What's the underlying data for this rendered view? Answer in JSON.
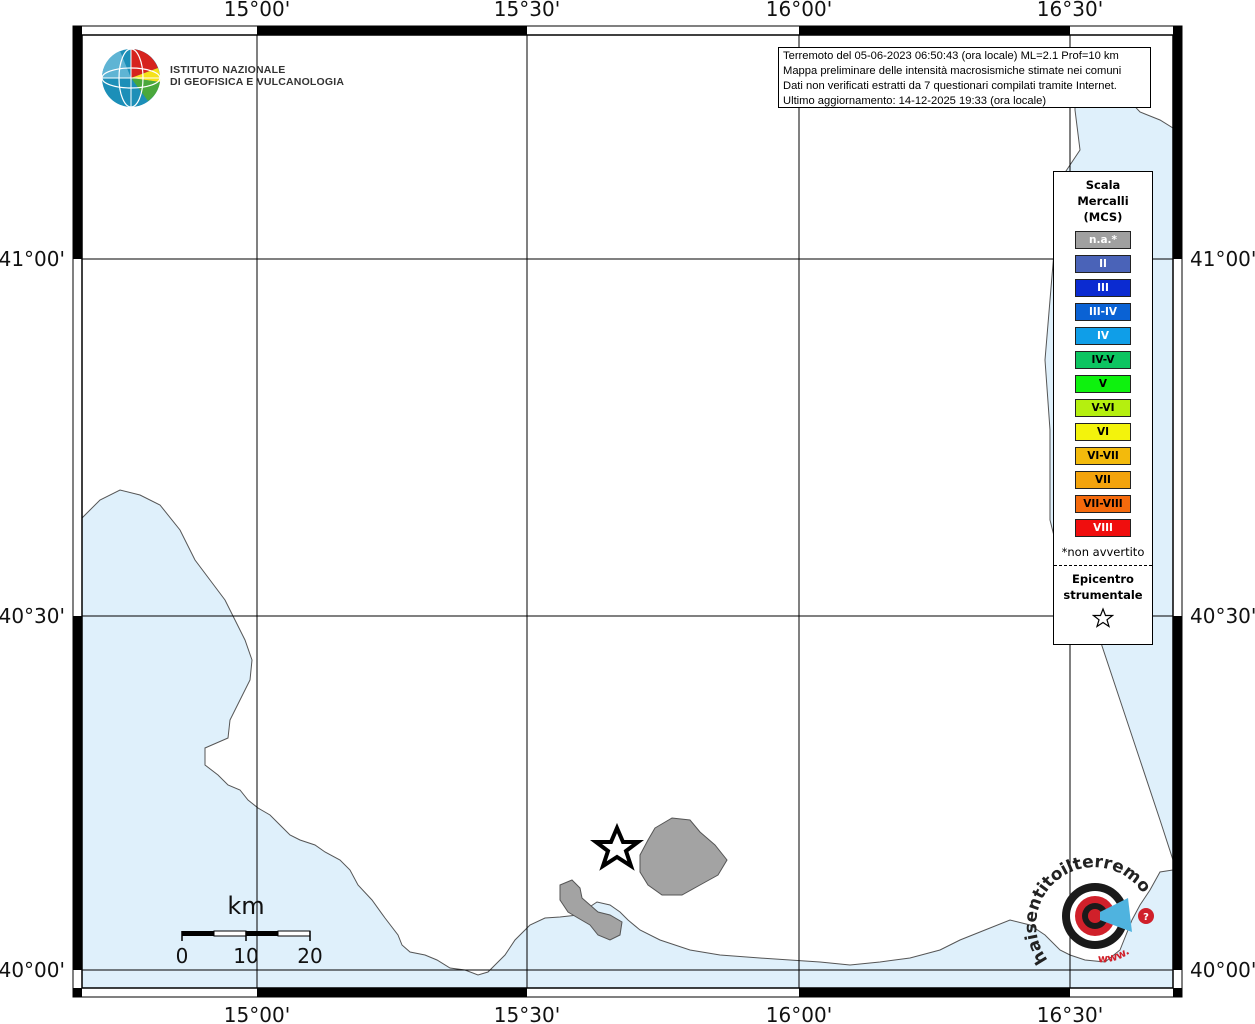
{
  "map": {
    "colors": {
      "sea": "#dff0fb",
      "land": "#ffffff",
      "coast": "#555555",
      "island": "#a3a3a3",
      "frame": "#000000",
      "grid": "#000000"
    },
    "lon_ticks": [
      "15°00'",
      "15°30'",
      "16°00'",
      "16°30'"
    ],
    "lat_ticks": [
      "41°00'",
      "40°30'",
      "40°00'"
    ]
  },
  "logo": {
    "line1": "ISTITUTO NAZIONALE",
    "line2": "DI GEOFISICA E VULCANOLOGIA",
    "icon": "ingv-globe-icon"
  },
  "info": {
    "lines": [
      "Terremoto del 05-06-2023 06:50:43 (ora locale) ML=2.1 Prof=10 km",
      "Mappa preliminare delle intensità macrosismiche stimate nei comuni",
      "Dati non verificati estratti da 7 questionari compilati tramite Internet.",
      "Ultimo aggiornamento: 14-12-2025 19:33 (ora locale)"
    ]
  },
  "legend": {
    "title_lines": [
      "Scala",
      "Mercalli",
      "(MCS)"
    ],
    "items": [
      {
        "label": "n.a.*",
        "color": "#a0a0a0",
        "text_color": "#ffffff"
      },
      {
        "label": "II",
        "color": "#4a63b8",
        "text_color": "#ffffff"
      },
      {
        "label": "III",
        "color": "#0b2bd1",
        "text_color": "#ffffff"
      },
      {
        "label": "III-IV",
        "color": "#0a62d4",
        "text_color": "#ffffff"
      },
      {
        "label": "IV",
        "color": "#0f9ee8",
        "text_color": "#ffffff"
      },
      {
        "label": "IV-V",
        "color": "#0dc561",
        "text_color": "#000000"
      },
      {
        "label": "V",
        "color": "#0ef20e",
        "text_color": "#000000"
      },
      {
        "label": "V-VI",
        "color": "#b5ef0f",
        "text_color": "#000000"
      },
      {
        "label": "VI",
        "color": "#f3f30c",
        "text_color": "#000000"
      },
      {
        "label": "VI-VII",
        "color": "#f3ba0c",
        "text_color": "#000000"
      },
      {
        "label": "VII",
        "color": "#f3a30c",
        "text_color": "#000000"
      },
      {
        "label": "VII-VIII",
        "color": "#f56a0c",
        "text_color": "#000000"
      },
      {
        "label": "VIII",
        "color": "#f00e0e",
        "text_color": "#ffffff"
      }
    ],
    "note": "*non avvertito",
    "epicenter_lines": [
      "Epicentro",
      "strumentale"
    ],
    "star_icon": "star-outline-icon"
  },
  "scale_bar": {
    "unit": "km",
    "labels": [
      "0",
      "10",
      "20"
    ]
  },
  "watermark": {
    "text": "haisentitoilterremoto.it",
    "alt_text": "www.",
    "icon": "target-megaphone-icon"
  }
}
